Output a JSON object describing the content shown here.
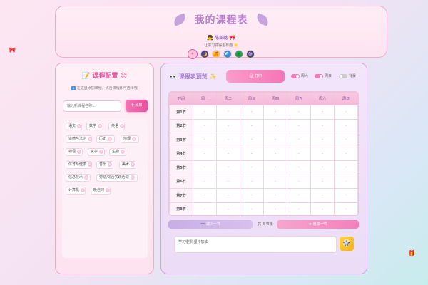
{
  "header": {
    "title": "我的课程表",
    "author": "陈亚璐",
    "author_emoji_left": "👧",
    "author_emoji_right": "🎀",
    "tagline": "让学习变得更有趣",
    "tagline_emoji": "🌟",
    "theme_icons": [
      "🌸",
      "🌙",
      "🍊",
      "🌊",
      "🌲",
      "🔮"
    ]
  },
  "config_panel": {
    "icon": "📝",
    "title": "课程配置",
    "title_emoji": "😊",
    "tip_icon": "ℹ",
    "tip": "在这里添加课程，点击课程即可选择哦",
    "input_placeholder": "输入新课程名称...",
    "add_label": "添加",
    "courses": [
      "语文",
      "数学",
      "英语",
      "道德与法治",
      "历史",
      "地理",
      "物理",
      "化学",
      "生物",
      "体育与健康",
      "音乐",
      "美术",
      "信息技术",
      "劳动/综合实践活动",
      "计算机",
      "晚自习"
    ]
  },
  "preview": {
    "title": "课程表预览",
    "title_icon": "👀",
    "title_emoji": "✨",
    "print_label": "打印",
    "toggles": [
      {
        "label": "周六",
        "on": true
      },
      {
        "label": "周日",
        "on": true
      },
      {
        "label": "背景",
        "on": false
      }
    ],
    "columns": [
      "时间",
      "周一",
      "周二",
      "周三",
      "周四",
      "周五",
      "周六",
      "周日"
    ],
    "periods": [
      "第1节",
      "第2节",
      "第3节",
      "第4节",
      "第5节",
      "第6节",
      "第7节",
      "第8节"
    ],
    "empty_cell": "-",
    "minus_label": "减少一节",
    "count_text": "共 8 节课",
    "plus_label": "增加一节",
    "note": "学习很累,坚持加油"
  },
  "colors": {
    "accent_pink": "#ec4f9d",
    "accent_purple": "#a77fd0",
    "dice": "#f5b012"
  }
}
